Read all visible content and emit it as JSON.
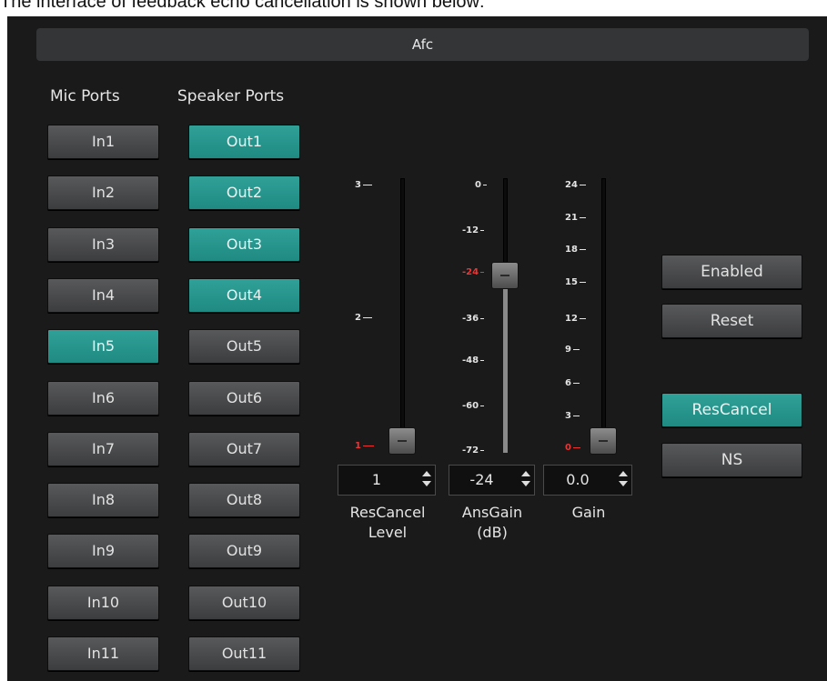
{
  "caption": "The interface of feedback echo cancellation is shown below:",
  "title": "Afc",
  "columns": {
    "mic": "Mic Ports",
    "speaker": "Speaker Ports"
  },
  "mic_ports": [
    "In1",
    "In2",
    "In3",
    "In4",
    "In5",
    "In6",
    "In7",
    "In8",
    "In9",
    "In10",
    "In11"
  ],
  "speaker_ports": [
    "Out1",
    "Out2",
    "Out3",
    "Out4",
    "Out5",
    "Out6",
    "Out7",
    "Out8",
    "Out9",
    "Out10",
    "Out11"
  ],
  "active_mic": [
    "In5"
  ],
  "active_speaker": [
    "Out1",
    "Out2",
    "Out3",
    "Out4"
  ],
  "sliders": {
    "rescancel": {
      "ticks": [
        "3",
        "2",
        "1"
      ],
      "value": "1",
      "label1": "ResCancel",
      "label2": "Level"
    },
    "ansgain": {
      "ticks": [
        "0",
        "-12",
        "-24",
        "-36",
        "-48",
        "-60",
        "-72"
      ],
      "value": "-24",
      "label1": "AnsGain",
      "label2": "(dB)"
    },
    "gain": {
      "ticks": [
        "24",
        "21",
        "18",
        "15",
        "12",
        "9",
        "6",
        "3",
        "0"
      ],
      "value": "0.0",
      "label1": "Gain"
    }
  },
  "side_buttons": {
    "enabled": "Enabled",
    "reset": "Reset",
    "rescancel": "ResCancel",
    "ns": "NS"
  },
  "colors": {
    "accent": "#249088",
    "panel": "#1a1a1a",
    "button": "#4a4b4d",
    "marker": "#e33333"
  }
}
